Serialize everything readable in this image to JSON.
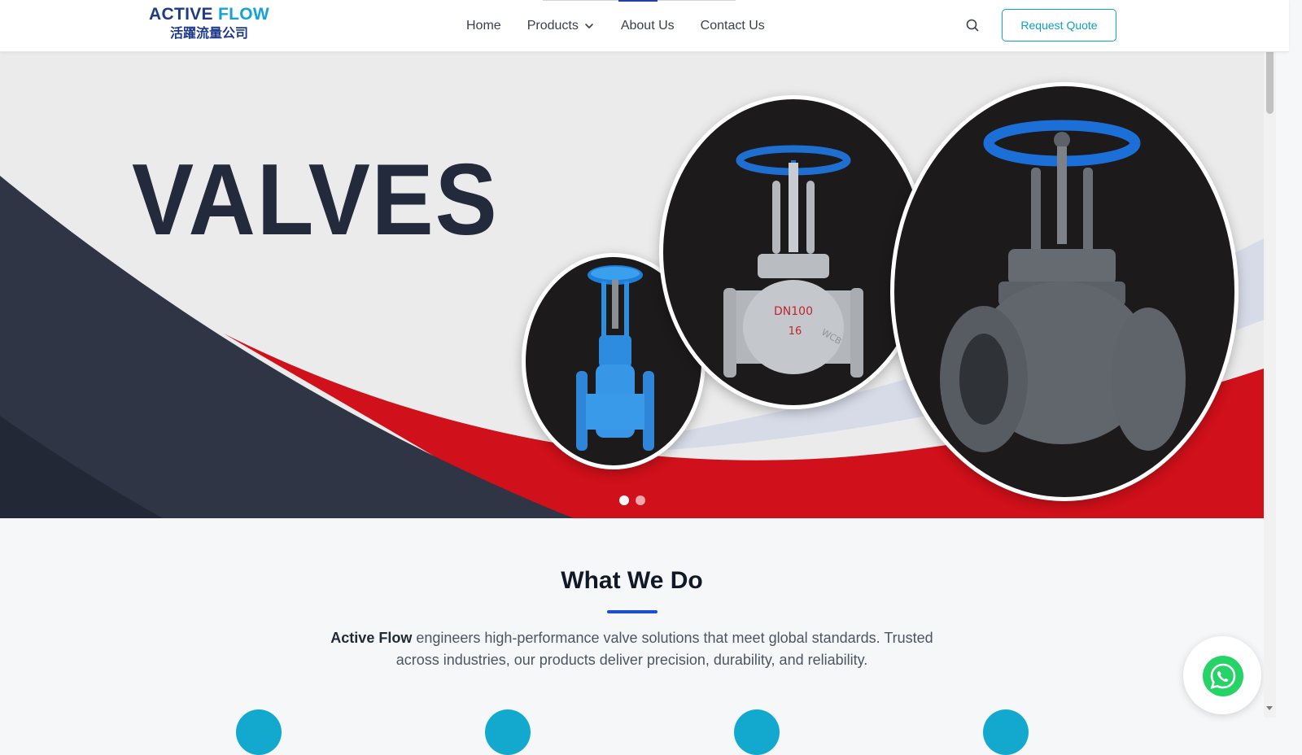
{
  "header": {
    "logo": {
      "line1_part1": "ACTIVE",
      "line1_part2": "FLOW",
      "line2": "活躍流量公司"
    },
    "nav": {
      "home": "Home",
      "products": "Products",
      "about": "About Us",
      "contact": "Contact Us"
    },
    "request_quote": "Request Quote",
    "icons": {
      "search": "search-icon",
      "dropdown": "chevron-down-icon"
    }
  },
  "hero": {
    "title": "VALVES",
    "slides": {
      "count": 2,
      "active": 1
    },
    "valve_markings": {
      "size": "DN100",
      "pressure": "16",
      "material": "WCB"
    },
    "colors": {
      "dark": "#2f3545",
      "red": "#d0101a",
      "background": "#ebebeb"
    }
  },
  "what_we_do": {
    "title": "What We Do",
    "intro_bold": "Active Flow",
    "intro_rest": " engineers high-performance valve solutions that meet global standards. Trusted across industries, our products deliver precision, durability, and reliability."
  },
  "floating": {
    "whatsapp_icon": "whatsapp-icon"
  },
  "colors": {
    "primary": "#1e3a8a",
    "accent": "#0ea5c6",
    "underline": "#1d4ed8",
    "feature_icon": "#13a9cf",
    "whatsapp": "#25d366"
  }
}
